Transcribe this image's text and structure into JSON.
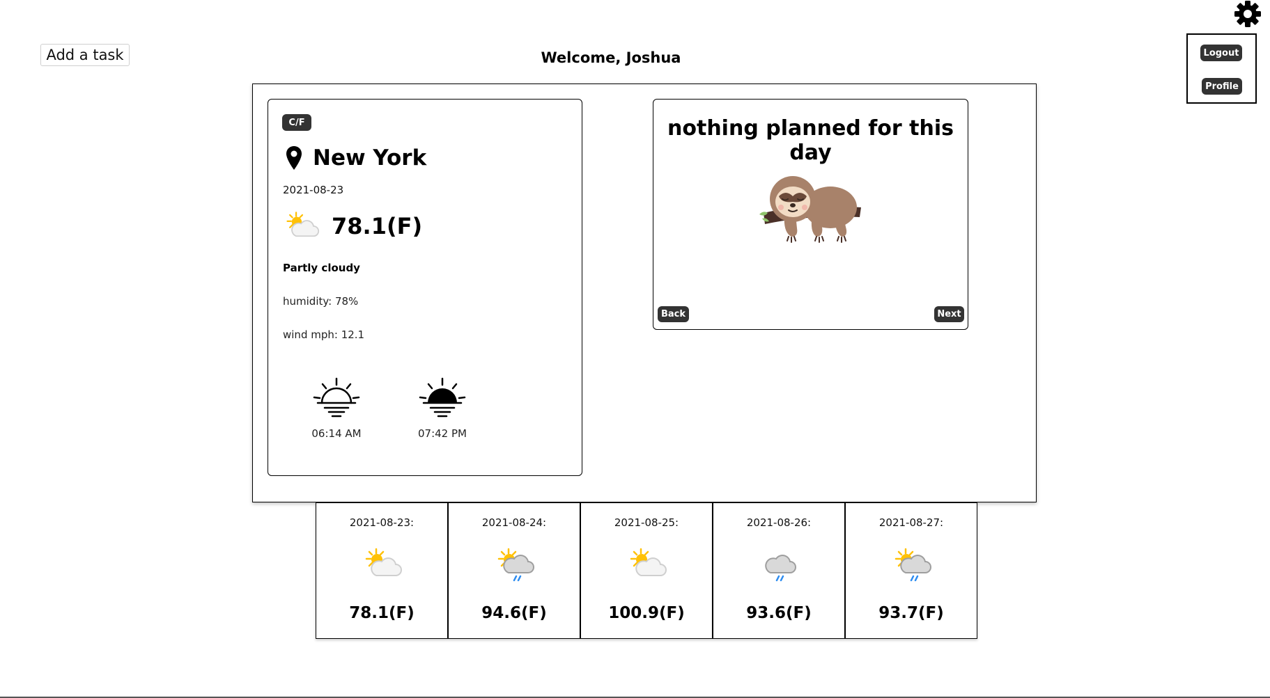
{
  "header": {
    "add_task_label": "Add a task",
    "welcome": "Welcome, Joshua"
  },
  "account_menu": {
    "logout_label": "Logout",
    "profile_label": "Profile",
    "settings_icon": "gear-icon"
  },
  "weather": {
    "unit_toggle_label": "C/F",
    "city": "New York",
    "location_icon": "map-pin-icon",
    "date": "2021-08-23",
    "condition_icon": "partly-cloudy-icon",
    "temperature": "78.1(F)",
    "condition": "Partly cloudy",
    "humidity": "humidity: 78%",
    "wind": "wind mph: 12.1",
    "sunrise_icon": "sunrise-icon",
    "sunrise": "06:14 AM",
    "sunset_icon": "sunset-icon",
    "sunset": "07:42 PM"
  },
  "planner": {
    "message": "nothing planned for this day",
    "image": "sleeping-sloth",
    "back_label": "Back",
    "next_label": "Next"
  },
  "forecast": [
    {
      "date": "2021-08-23:",
      "icon": "partly-cloudy-icon",
      "temp": "78.1(F)"
    },
    {
      "date": "2021-08-24:",
      "icon": "sun-cloud-rain-icon",
      "temp": "94.6(F)"
    },
    {
      "date": "2021-08-25:",
      "icon": "partly-cloudy-icon",
      "temp": "100.9(F)"
    },
    {
      "date": "2021-08-26:",
      "icon": "cloud-rain-icon",
      "temp": "93.6(F)"
    },
    {
      "date": "2021-08-27:",
      "icon": "sun-cloud-rain-icon",
      "temp": "93.7(F)"
    }
  ],
  "colors": {
    "button_dark": "#333333",
    "sun_yellow": "#ffc107",
    "cloud_gray": "#d9d9d9",
    "rain_blue": "#2d8cf0",
    "sloth_brown": "#a8826a"
  }
}
